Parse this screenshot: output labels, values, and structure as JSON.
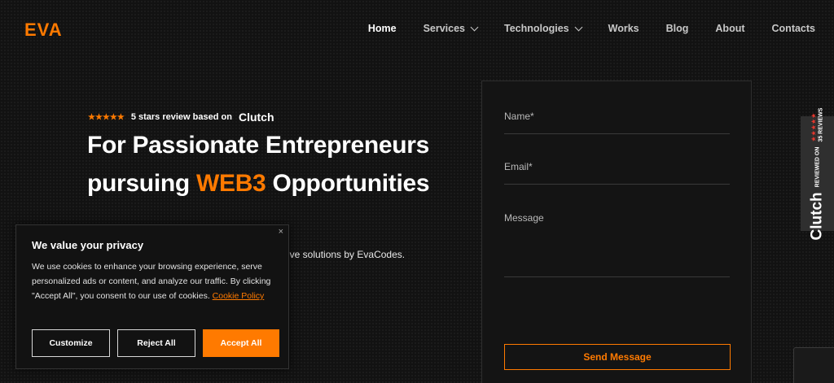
{
  "header": {
    "logo": "EVA",
    "nav": [
      {
        "label": "Home",
        "active": true,
        "dropdown": false
      },
      {
        "label": "Services",
        "active": false,
        "dropdown": true
      },
      {
        "label": "Technologies",
        "active": false,
        "dropdown": true
      },
      {
        "label": "Works",
        "active": false,
        "dropdown": false
      },
      {
        "label": "Blog",
        "active": false,
        "dropdown": false
      },
      {
        "label": "About",
        "active": false,
        "dropdown": false
      },
      {
        "label": "Contacts",
        "active": false,
        "dropdown": false
      }
    ]
  },
  "hero": {
    "stars": "★★★★★",
    "review_text": "5 stars review based on",
    "review_brand": "Clutch",
    "title_line1": "For Passionate Entrepreneurs",
    "title_line2_pre": "pursuing ",
    "title_line2_accent": "WEB3",
    "title_line2_post": " Opportunities",
    "subtitle_visible": "ative solutions by EvaCodes."
  },
  "form": {
    "name_placeholder": "Name*",
    "email_placeholder": "Email*",
    "message_placeholder": "Message",
    "send_label": "Send Message"
  },
  "side_badge": {
    "reviewed_on": "REVIEWED ON",
    "brand": "Clutch",
    "stars": "★★★★★",
    "reviews": "35 REVIEWS"
  },
  "cookie": {
    "close": "×",
    "title": "We value your privacy",
    "body": "We use cookies to enhance your browsing experience, serve personalized ads or content, and analyze our traffic. By clicking \"Accept All\", you consent to our use of cookies.",
    "link": "Cookie Policy",
    "customize": "Customize",
    "reject": "Reject All",
    "accept": "Accept All"
  },
  "colors": {
    "accent": "#ff7a00",
    "background": "#121212",
    "badge_star": "#e6372e"
  }
}
